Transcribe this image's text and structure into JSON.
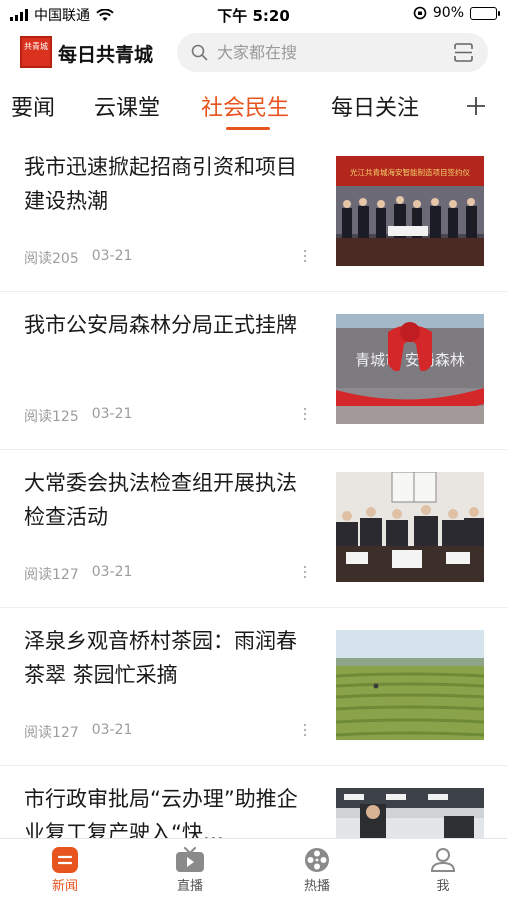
{
  "status_bar": {
    "carrier": "中国联通",
    "time": "下午 5:20",
    "battery": "90%",
    "battery_level": 0.9
  },
  "header": {
    "app_title": "每日共青城",
    "logo_text": "共青城",
    "search_placeholder": "大家都在搜"
  },
  "tabs": [
    {
      "label": "要闻",
      "active": false
    },
    {
      "label": "云课堂",
      "active": false
    },
    {
      "label": "社会民生",
      "active": true
    },
    {
      "label": "每日关注",
      "active": false
    }
  ],
  "feed": [
    {
      "title": "我市迅速掀起招商引资和项目建设热潮",
      "reads": "阅读205",
      "date": "03-21",
      "banner_text": "光江共青城海安智能制造项目签约仪"
    },
    {
      "title": "我市公安局森林分局正式挂牌",
      "reads": "阅读125",
      "date": "03-21",
      "banner_text": "青城市 安局森林"
    },
    {
      "title": "大常委会执法检查组开展执法检查活动",
      "reads": "阅读127",
      "date": "03-21"
    },
    {
      "title": "泽泉乡观音桥村茶园：雨润春茶翠  茶园忙采摘",
      "reads": "阅读127",
      "date": "03-21"
    },
    {
      "title": "市行政审批局“云办理”助推企业复工复产驶入“快…",
      "reads": "",
      "date": ""
    }
  ],
  "bottom_nav": [
    {
      "label": "新闻",
      "icon": "news-icon",
      "active": true
    },
    {
      "label": "直播",
      "icon": "live-tv-icon",
      "active": false
    },
    {
      "label": "热播",
      "icon": "film-reel-icon",
      "active": false
    },
    {
      "label": "我",
      "icon": "profile-icon",
      "active": false
    }
  ],
  "colors": {
    "accent": "#e8541e",
    "logo_red": "#d9331f"
  }
}
